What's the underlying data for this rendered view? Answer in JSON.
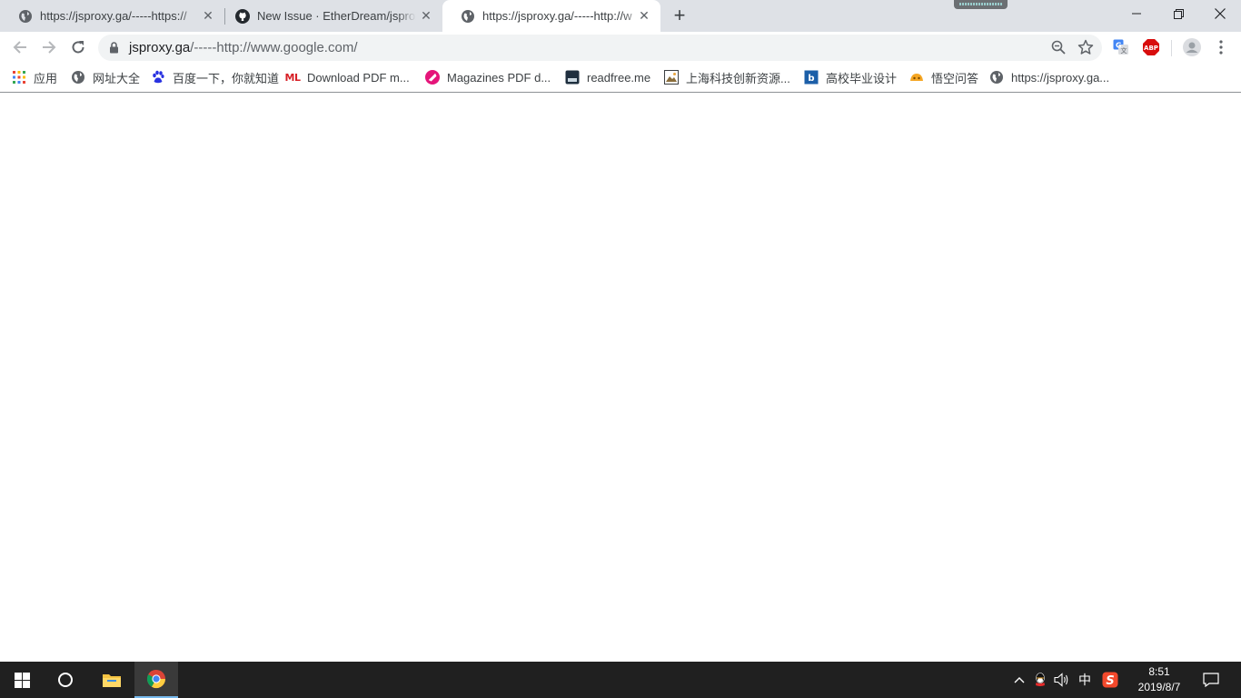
{
  "tabs": [
    {
      "title": "https://jsproxy.ga/-----https://",
      "favicon": "globe-icon",
      "active": false
    },
    {
      "title": "New Issue · EtherDream/jsprox",
      "favicon": "github-icon",
      "active": false
    },
    {
      "title": "https://jsproxy.ga/-----http://w",
      "favicon": "globe-icon",
      "active": true
    }
  ],
  "toolbar": {
    "url_host": "jsproxy.ga",
    "url_rest": "/-----http://www.google.com/",
    "extensions": [
      "translate-icon",
      "adblock-plus-icon"
    ],
    "abp_label": "ABP"
  },
  "bookmarks": [
    {
      "label": "应用",
      "icon": "apps-grid-icon"
    },
    {
      "label": "网址大全",
      "icon": "globe-icon"
    },
    {
      "label": "百度一下，你就知道",
      "icon": "baidu-paw-icon"
    },
    {
      "label": "Download PDF m...",
      "icon": "ml-logo-icon",
      "icon_text": "ML"
    },
    {
      "label": "Magazines PDF d...",
      "icon": "magazine-icon"
    },
    {
      "label": "readfree.me",
      "icon": "readfree-icon"
    },
    {
      "label": "上海科技创新资源...",
      "icon": "image-icon"
    },
    {
      "label": "高校毕业设计",
      "icon": "bookmark-blue-icon"
    },
    {
      "label": "悟空问答",
      "icon": "wukong-icon"
    },
    {
      "label": "https://jsproxy.ga...",
      "icon": "globe-icon"
    }
  ],
  "taskbar": {
    "tray": {
      "ime": "中",
      "sogou": "S"
    },
    "clock": {
      "time": "8:51",
      "date": "2019/8/7"
    }
  },
  "colors": {
    "tabstrip": "#dee1e6",
    "omnibox": "#f1f3f4",
    "taskbar": "#202020",
    "abp_red": "#d80d0d",
    "ml_red": "#d71f26",
    "magazine_pink": "#e5157a"
  }
}
